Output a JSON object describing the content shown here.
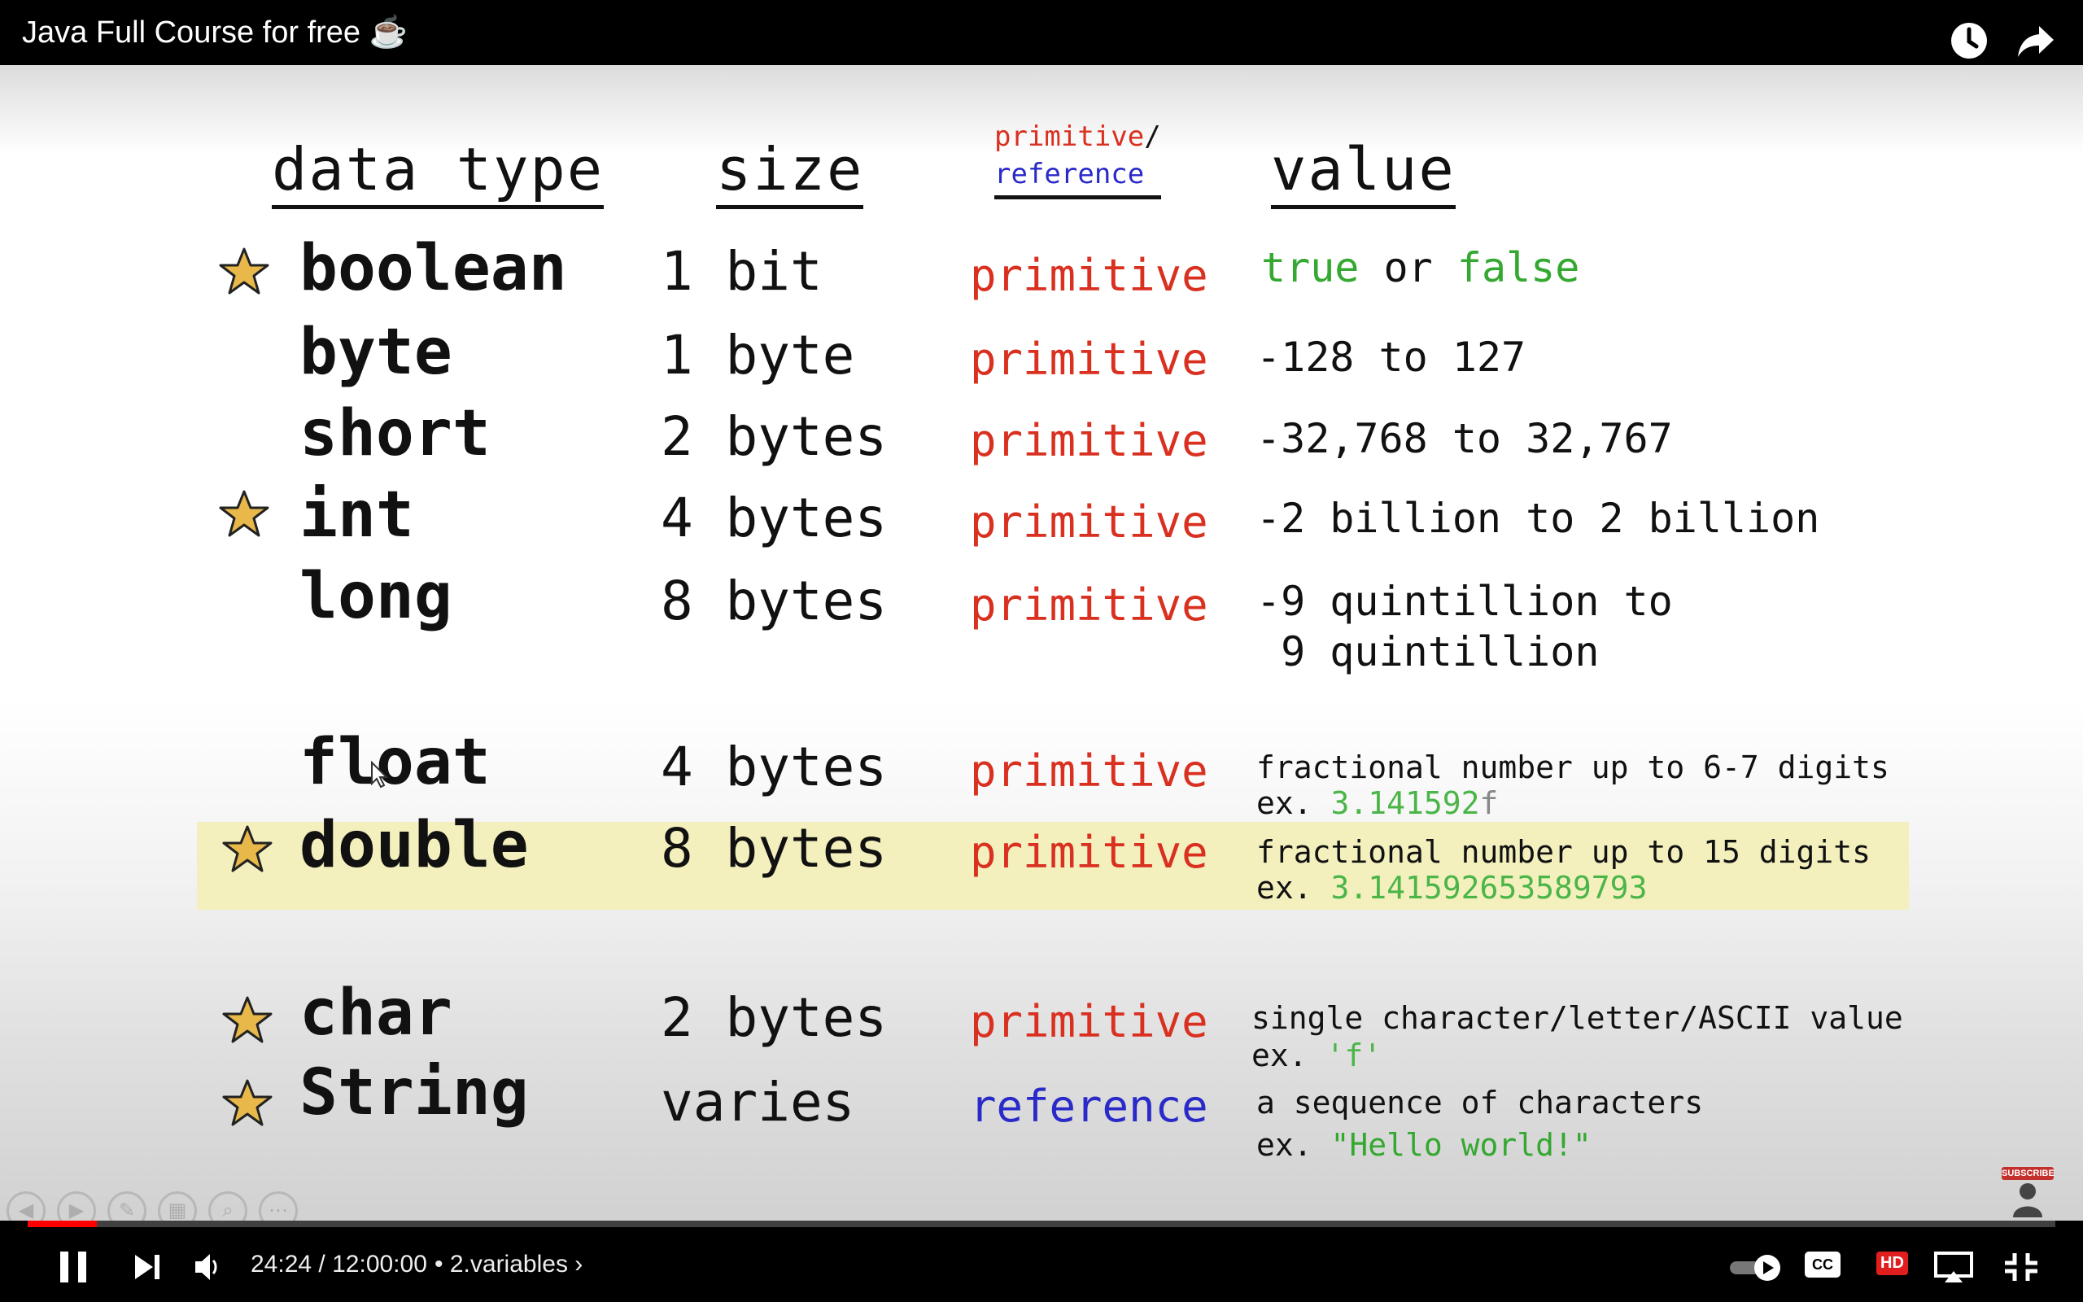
{
  "player": {
    "title": "Java Full Course for free ☕",
    "current_time": "24:24",
    "separator": "/",
    "duration": "12:00:00",
    "chapter_bullet": "•",
    "chapter": "2.variables",
    "chapter_chevron": "›",
    "progress_fraction": 0.034,
    "quality_badge": "HD",
    "cc_label": "CC",
    "accent": "#ff0000",
    "subscribe_label": "SUBSCRIBE"
  },
  "slide": {
    "headers": {
      "data_type": "data type",
      "size": "size",
      "kind_top": "primitive",
      "kind_slash": "/",
      "kind_bottom": "reference",
      "value": "value"
    },
    "rows": [
      {
        "type": "boolean",
        "size": "1 bit",
        "kind": "primitive",
        "star": true,
        "value_a": "true",
        "value_mid": " or ",
        "value_b": "false"
      },
      {
        "type": "byte",
        "size": "1 byte",
        "kind": "primitive",
        "star": false,
        "value": "-128 to 127"
      },
      {
        "type": "short",
        "size": "2 bytes",
        "kind": "primitive",
        "star": false,
        "value": "-32,768 to 32,767"
      },
      {
        "type": "int",
        "size": "4 bytes",
        "kind": "primitive",
        "star": true,
        "value": "-2 billion to 2 billion"
      },
      {
        "type": "long",
        "size": "8 bytes",
        "kind": "primitive",
        "star": false,
        "value_line1": "-9 quintillion to",
        "value_line2": " 9 quintillion"
      },
      {
        "type": "float",
        "size": "4 bytes",
        "kind": "primitive",
        "star": false,
        "value_line1": "fractional number up to 6-7 digits",
        "ex_prefix": "ex. ",
        "ex_value": "3.141592",
        "ex_suffix": "f"
      },
      {
        "type": "double",
        "size": "8 bytes",
        "kind": "primitive",
        "star": true,
        "highlighted": true,
        "value_line1": "fractional number up to 15 digits",
        "ex_prefix": "ex. ",
        "ex_value": "3.141592653589793"
      },
      {
        "type": "char",
        "size": "2 bytes",
        "kind": "primitive",
        "star": true,
        "value_line1": "single character/letter/ASCII value",
        "ex_prefix": "ex. ",
        "ex_value": "'f'"
      },
      {
        "type": "String",
        "size": "varies",
        "kind": "reference",
        "star": true,
        "value_line1": "a sequence of characters",
        "ex_prefix": "ex. ",
        "ex_value": "\"Hello world!\""
      }
    ],
    "colors": {
      "primitive": "#d93020",
      "reference": "#2a2ac8",
      "example": "#34a830",
      "highlight": "#f3f0be",
      "star": "#e8b84a"
    }
  }
}
